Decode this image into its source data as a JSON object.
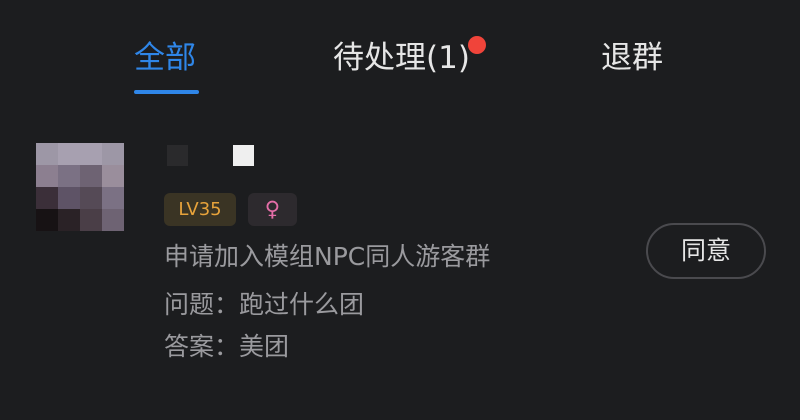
{
  "tabs": {
    "all": "全部",
    "pending": "待处理(1)",
    "quit": "退群",
    "pending_has_notification": true,
    "active_color": "#2f86e8",
    "notification_color": "#f0443a"
  },
  "request": {
    "level": "LV35",
    "gender_symbol": "♀",
    "message": "申请加入模组NPC同人游客群",
    "question_label": "问题：",
    "question_value": "跑过什么团",
    "answer_label": "答案：",
    "answer_value": "美团",
    "accept_label": "同意"
  },
  "colors": {
    "background": "#1c1d1f",
    "level_text": "#e7a33b",
    "gender_text": "#e56ea8",
    "secondary_text": "#9a9a9e"
  }
}
